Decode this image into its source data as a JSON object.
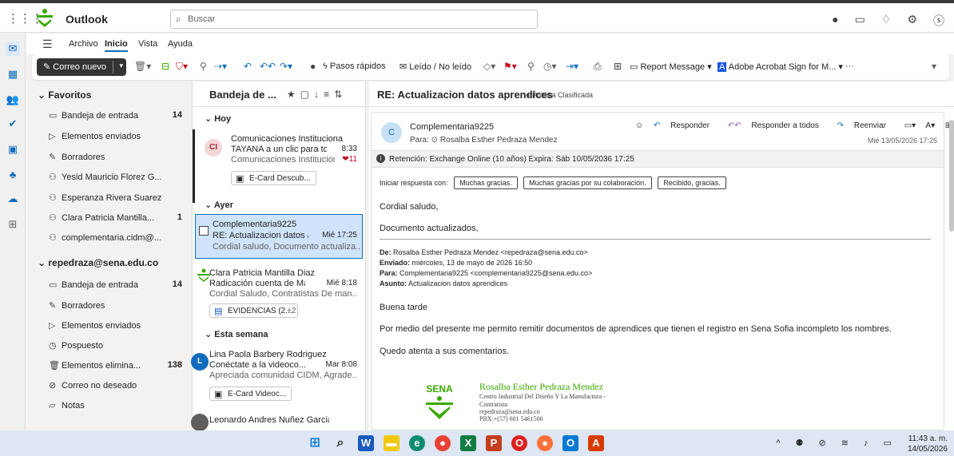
{
  "app": {
    "title": "Outlook",
    "search_placeholder": "Buscar"
  },
  "colors": {
    "accent": "#0f6cbd",
    "sena_green": "#39a900",
    "dark": "#343434"
  },
  "menu": [
    "Archivo",
    "Inicio",
    "Vista",
    "Ayuda"
  ],
  "ribbon": {
    "new_mail": "Correo nuevo",
    "quick_steps": "Pasos rápidos",
    "read_unread": "Leído / No leído",
    "report": "Report Message",
    "acrobat": "Adobe Acrobat Sign for M...",
    "more": "···"
  },
  "folders": {
    "favorites_title": "Favoritos",
    "favorites": [
      {
        "label": "Bandeja de entrada",
        "count": "14",
        "icon": "inbox-icon"
      },
      {
        "label": "Elementos enviados",
        "count": "",
        "icon": "send-icon"
      },
      {
        "label": "Borradores",
        "count": "",
        "icon": "draft-icon"
      },
      {
        "label": "Yesid Mauricio Florez G...",
        "count": "",
        "icon": "person-icon"
      },
      {
        "label": "Esperanza Rivera Suarez",
        "count": "",
        "icon": "person-icon"
      },
      {
        "label": "Clara Patricia Mantilla...",
        "count": "1",
        "icon": "person-icon"
      },
      {
        "label": "complementaria.cidm@...",
        "count": "",
        "icon": "person-icon"
      }
    ],
    "account_title": "repedraza@sena.edu.co",
    "account": [
      {
        "label": "Bandeja de entrada",
        "count": "14"
      },
      {
        "label": "Borradores",
        "count": ""
      },
      {
        "label": "Elementos enviados",
        "count": ""
      },
      {
        "label": "Pospuesto",
        "count": ""
      },
      {
        "label": "Elementos elimina...",
        "count": "138"
      },
      {
        "label": "Correo no deseado",
        "count": ""
      },
      {
        "label": "Notas",
        "count": ""
      }
    ]
  },
  "list": {
    "title": "Bandeja de ...",
    "groups": [
      "Hoy",
      "Ayer",
      "Esta semana"
    ],
    "messages": [
      {
        "initials": "CI",
        "sender": "Comunicaciones Institucionales",
        "subject": "TAYANA a un clic para toda l...",
        "time": "8:33",
        "preview": "Comunicaciones Institucional...",
        "badge": "11",
        "attachment": "E-Card Descub..."
      },
      {
        "initials": "",
        "sender": "Complementaria9225",
        "subject": "RE: Actualizacion datos a...",
        "time": "Mié 17:25",
        "preview": "Cordial saludo, Documento actualiza...",
        "badge": "",
        "attachment": ""
      },
      {
        "initials": "",
        "sender": "Clara Patricia Mantilla Diaz",
        "subject": "Radicación cuenta de Mayo",
        "time": "Mié 8:18",
        "preview": "Cordial Saludo, Contratistas De man...",
        "badge": "",
        "attachment": "EVIDENCIAS (2...",
        "extra": "+2"
      },
      {
        "initials": "L",
        "sender": "Lina Paola Barbery Rodriguez",
        "subject": "Conéctate a la videoco...",
        "time": "Mar 8:08",
        "preview": "Apreciada comunidad CIDM, Agrade...",
        "badge": "",
        "attachment": "E-Card Videoc..."
      },
      {
        "initials": "",
        "sender": "Leonardo Andres Nuñez Garcia",
        "subject": "",
        "time": "",
        "preview": "",
        "badge": "",
        "attachment": ""
      }
    ]
  },
  "reading": {
    "subject": "RE: Actualizacion datos aprendices",
    "label": "Pública Clasificada",
    "from_initial": "C",
    "from": "Complementaria9225",
    "to": "Para: ⊙ Rosalba Esther Pedraza Mendez",
    "reply": "Responder",
    "reply_all": "Responder a todos",
    "forward": "Reenviar",
    "date": "Mié 13/05/2026 17:25",
    "retention": "Retención: Exchange Online (10 años) Expira: Sáb 10/05/2036 17:25",
    "quick_label": "Iniciar respuesta con:",
    "quick_replies": [
      "Muchas gracias.",
      "Muchas gracias por su colaboración.",
      "Recibido, gracias."
    ],
    "greeting": "Cordial saludo,",
    "line1": "Documento actualizados,",
    "orig_from_label": "De:",
    "orig_from": " Rosalba Esther Pedraza Mendez <repedraza@sena.edu.co>",
    "orig_sent_label": "Enviado:",
    "orig_sent": " miércoles, 13 de mayo de 2026 16:50",
    "orig_to_label": "Para:",
    "orig_to": " Complementaria9225 <complementaria9225@sena.edu.co>",
    "orig_subj_label": "Asunto:",
    "orig_subj": " Actualizacion datos aprendices",
    "body1": "Buena tarde",
    "body2": "Por medio del presente me permito remitir documentos de aprendices que tienen el registro en Sena Sofia incompleto los nombres.",
    "body3": "Quedo atenta a sus comentarios.",
    "sig_name": "Rosalba Esther Pedraza Mendez",
    "sig_org": "Centro Industrial Del Diseño Y La Manufactura -",
    "sig_role": "Contratista",
    "sig_email": "repedraza@sena.edu.co",
    "sig_phone": "PBX:+(57) 601 5461500",
    "sig_logo": "SENA"
  },
  "taskbar": {
    "time": "11:43 a. m.",
    "date": "14/05/2026"
  }
}
